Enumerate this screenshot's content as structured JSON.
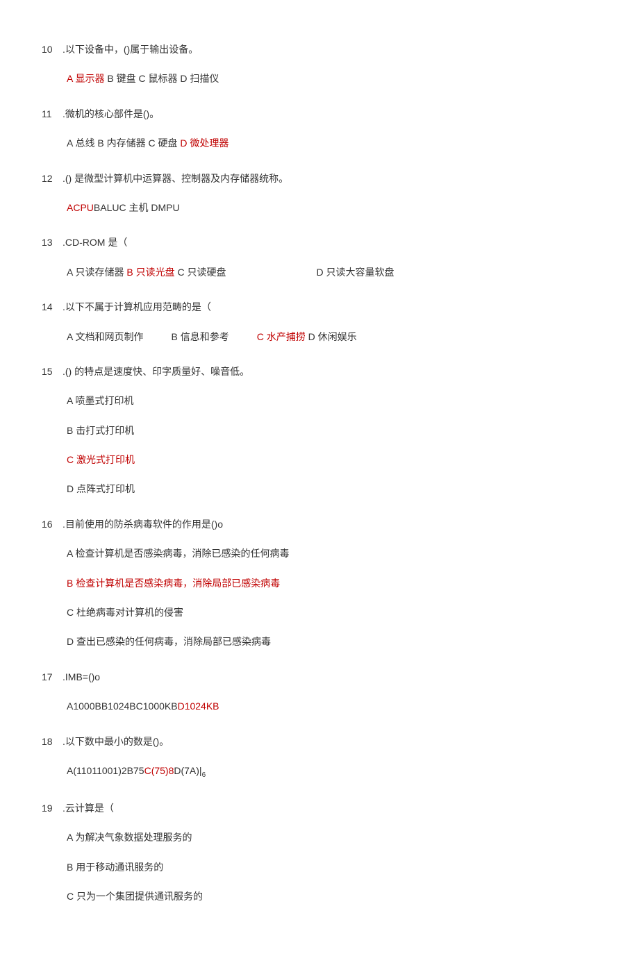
{
  "questions": [
    {
      "num": "10",
      "stem": ".以下设备中，()属于输出设备。",
      "lines": [
        {
          "parts": [
            {
              "t": "A 显示器",
              "red": true
            },
            {
              "t": " B 键盘 C 鼠标器 D 扫描仪",
              "red": false
            }
          ]
        }
      ]
    },
    {
      "num": "11",
      "stem": ".微机的核心部件是()。",
      "lines": [
        {
          "parts": [
            {
              "t": "A 总线 B 内存储器 C 硬盘 ",
              "red": false
            },
            {
              "t": "D 微处理器",
              "red": true
            }
          ]
        }
      ]
    },
    {
      "num": "12",
      "stem": ".() 是微型计算机中运算器、控制器及内存储器统称。",
      "lines": [
        {
          "parts": [
            {
              "t": "ACPU",
              "red": true
            },
            {
              "t": "BALUC 主机 DMPU",
              "red": false
            }
          ]
        }
      ]
    },
    {
      "num": "13",
      "stem": ".CD-ROM 是（",
      "lines": [
        {
          "parts": [
            {
              "t": "A 只读存储器 ",
              "red": false
            },
            {
              "t": "B 只读光盘",
              "red": true
            },
            {
              "t": " C 只读硬盘",
              "red": false
            },
            {
              "t": "",
              "gap": "gap"
            },
            {
              "t": "D 只读大容量软盘",
              "red": false
            }
          ]
        }
      ]
    },
    {
      "num": "14",
      "stem": ".以下不属于计算机应用范畴的是（",
      "lines": [
        {
          "parts": [
            {
              "t": "A 文档和网页制作",
              "red": false
            },
            {
              "t": "",
              "gap": "gap-sm"
            },
            {
              "t": "B 信息和参考",
              "red": false
            },
            {
              "t": "",
              "gap": "gap-sm"
            },
            {
              "t": "C 水产捕捞",
              "red": true
            },
            {
              "t": " D 休闲娱乐",
              "red": false
            }
          ]
        }
      ]
    },
    {
      "num": "15",
      "stem": ".() 的特点是速度快、印字质量好、噪音低。",
      "lines": [
        {
          "parts": [
            {
              "t": "A 喷墨式打印机",
              "red": false
            }
          ]
        },
        {
          "parts": [
            {
              "t": "B 击打式打印机",
              "red": false
            }
          ]
        },
        {
          "parts": [
            {
              "t": "C 激光式打印机",
              "red": true
            }
          ]
        },
        {
          "parts": [
            {
              "t": "D 点阵式打印机",
              "red": false
            }
          ]
        }
      ]
    },
    {
      "num": "16",
      "stem": ".目前使用的防杀病毒软件的作用是()o",
      "lines": [
        {
          "parts": [
            {
              "t": "A 检查计算机是否感染病毒，消除已感染的任何病毒",
              "red": false
            }
          ]
        },
        {
          "parts": [
            {
              "t": "B 检查计算机是否感染病毒，消除局部已感染病毒",
              "red": true
            }
          ]
        },
        {
          "parts": [
            {
              "t": "C 杜绝病毒对计算机的侵害",
              "red": false
            }
          ]
        },
        {
          "parts": [
            {
              "t": "D 查出已感染的任何病毒，消除局部已感染病毒",
              "red": false
            }
          ]
        }
      ]
    },
    {
      "num": "17",
      "stem": ".IMB=()o",
      "lines": [
        {
          "parts": [
            {
              "t": "A1000BB1024BC1000KB",
              "red": false
            },
            {
              "t": "D1024KB",
              "red": true
            }
          ]
        }
      ]
    },
    {
      "num": "18",
      "stem": ".以下数中最小的数是()。",
      "lines": [
        {
          "parts": [
            {
              "t": "A(11011001)2B75",
              "red": false
            },
            {
              "t": "C(75)8",
              "red": true
            },
            {
              "t": "D(7A)|",
              "red": false
            },
            {
              "t": "6",
              "red": false,
              "sub": true
            }
          ]
        }
      ]
    },
    {
      "num": "19",
      "stem": ".云计算是（",
      "lines": [
        {
          "parts": [
            {
              "t": "A 为解决气象数据处理服务的",
              "red": false
            }
          ]
        },
        {
          "parts": [
            {
              "t": "B 用于移动通讯服务的",
              "red": false
            }
          ]
        },
        {
          "parts": [
            {
              "t": "C 只为一个集团提供通讯服务的",
              "red": false
            }
          ]
        }
      ]
    }
  ]
}
